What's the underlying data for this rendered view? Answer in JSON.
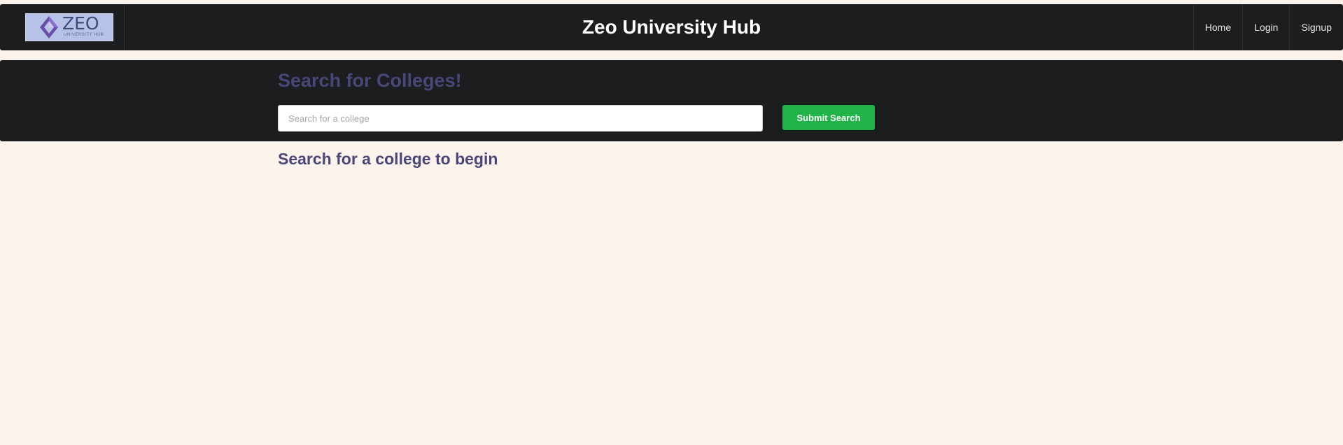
{
  "header": {
    "logo": {
      "main_text": "ZEO",
      "sub_text": "UNIVERSITY HUB"
    },
    "site_title": "Zeo University Hub",
    "nav": [
      {
        "label": "Home"
      },
      {
        "label": "Login"
      },
      {
        "label": "Signup"
      }
    ]
  },
  "search": {
    "heading": "Search for Colleges!",
    "input_value": "",
    "placeholder": "Search for a college",
    "submit_label": "Submit Search"
  },
  "results": {
    "empty_message": "Search for a college to begin"
  },
  "colors": {
    "page_background": "#fcf3ec",
    "bar_background": "#1b1d1f",
    "heading_purple": "#4a4677",
    "submit_green": "#1fb348"
  }
}
